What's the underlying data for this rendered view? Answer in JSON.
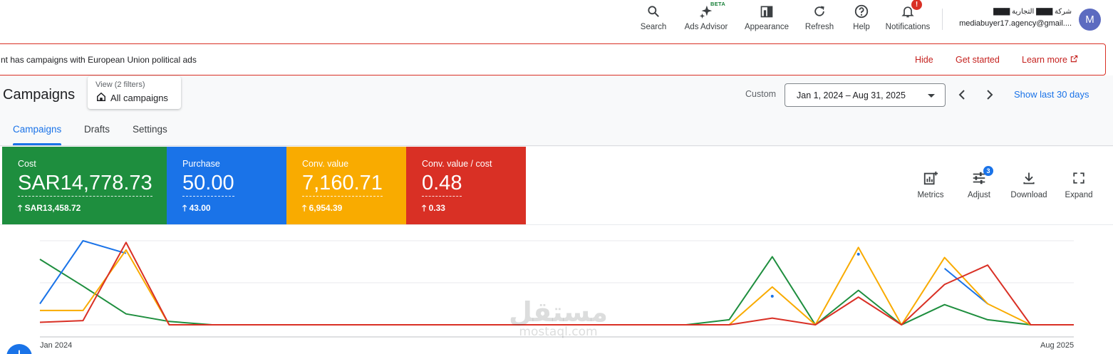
{
  "toolbar": {
    "items": [
      {
        "label": "Search",
        "icon": "search-icon"
      },
      {
        "label": "Ads Advisor",
        "icon": "sparkle-icon",
        "badge": "BETA"
      },
      {
        "label": "Appearance",
        "icon": "appearance-icon"
      },
      {
        "label": "Refresh",
        "icon": "refresh-icon"
      },
      {
        "label": "Help",
        "icon": "help-icon"
      },
      {
        "label": "Notifications",
        "icon": "bell-icon",
        "badge": "!"
      }
    ]
  },
  "account": {
    "name": "شركة ▇▇▇ التجارية ▇▇▇",
    "email": "mediabuyer17.agency@gmail....",
    "avatar_letter": "M",
    "avatar_color": "#5c6bc0"
  },
  "banner": {
    "text": "nt has campaigns with European Union political ads",
    "hide": "Hide",
    "get_started": "Get started",
    "learn_more": "Learn more",
    "border_color": "#d93025"
  },
  "page": {
    "title": "Campaigns",
    "view_sub": "View (2 filters)",
    "view_main": "All campaigns"
  },
  "date": {
    "custom_label": "Custom",
    "range": "Jan 1, 2024 – Aug 31, 2025",
    "show_last": "Show last 30 days"
  },
  "tabs": [
    "Campaigns",
    "Drafts",
    "Settings"
  ],
  "metrics": [
    {
      "label": "Cost",
      "value": "SAR14,778.73",
      "delta": "SAR13,458.72",
      "color": "#1e8e3e"
    },
    {
      "label": "Purchase",
      "value": "50.00",
      "delta": "43.00",
      "color": "#1a73e8"
    },
    {
      "label": "Conv. value",
      "value": "7,160.71",
      "delta": "6,954.39",
      "color": "#f9ab00"
    },
    {
      "label": "Conv. value / cost",
      "value": "0.48",
      "delta": "0.33",
      "color": "#d93025"
    }
  ],
  "tools": [
    {
      "label": "Metrics",
      "icon": "metrics-icon"
    },
    {
      "label": "Adjust",
      "icon": "adjust-icon",
      "badge": "3"
    },
    {
      "label": "Download",
      "icon": "download-icon"
    },
    {
      "label": "Expand",
      "icon": "expand-icon"
    }
  ],
  "chart_data": {
    "type": "line",
    "x_start_label": "Jan 2024",
    "x_end_label": "Aug 2025",
    "grid": true,
    "series": [
      {
        "color": "#1e8e3e",
        "values": [
          0.78,
          0.46,
          0.13,
          0.04,
          0,
          0,
          0,
          0,
          0,
          0,
          0,
          0,
          0,
          0,
          0,
          0,
          0.06,
          0.81,
          0,
          0.41,
          0,
          0.24,
          0.06,
          0,
          0
        ]
      },
      {
        "color": "#1a73e8",
        "values": [
          0.25,
          1.0,
          0.85,
          null,
          null,
          null,
          null,
          null,
          null,
          null,
          null,
          null,
          null,
          null,
          null,
          null,
          null,
          0.34,
          null,
          0.84,
          null,
          0.67,
          0.25,
          null,
          null
        ]
      },
      {
        "color": "#f9ab00",
        "values": [
          0.17,
          0.17,
          0.89,
          0,
          0,
          0,
          0,
          0,
          0,
          0,
          0,
          0,
          0,
          0,
          0,
          0,
          0,
          0.45,
          0,
          0.92,
          0,
          0.8,
          0.25,
          0,
          0
        ]
      },
      {
        "color": "#d93025",
        "values": [
          0.03,
          0.05,
          0.98,
          0,
          0,
          0,
          0,
          0,
          0,
          0,
          0,
          0,
          0,
          0,
          0,
          0,
          0,
          0.08,
          0,
          0.33,
          0,
          0.48,
          0.71,
          0,
          0
        ]
      }
    ]
  },
  "watermark": {
    "logo": "مستقل",
    "text": "mostaql.com"
  }
}
